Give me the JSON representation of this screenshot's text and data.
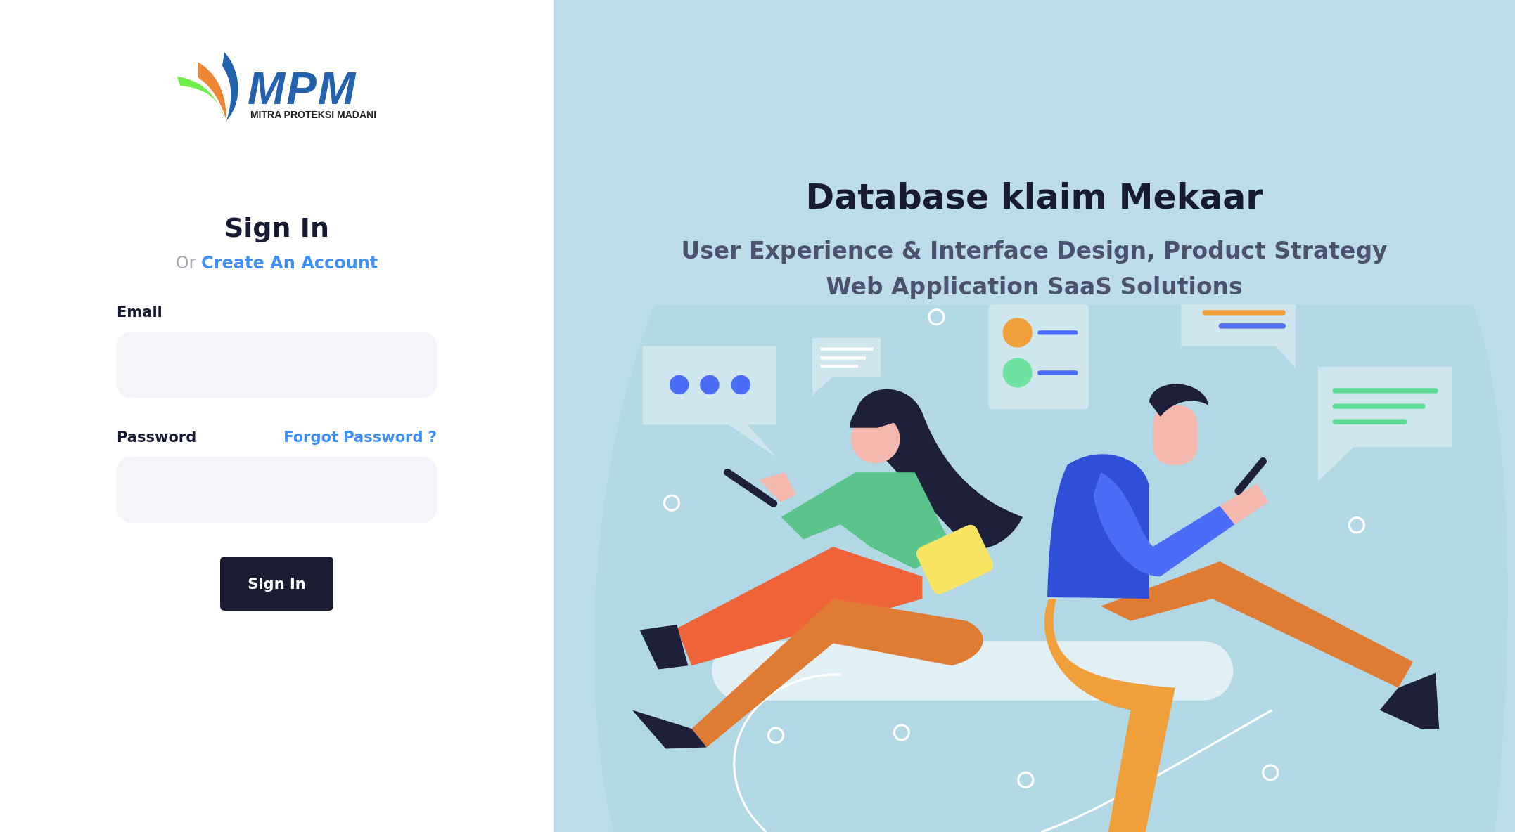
{
  "logo": {
    "wordmark": "MPM",
    "tagline": "MITRA PROTEKSI MADANI"
  },
  "sign_in": {
    "title": "Sign In",
    "alt_prefix": "Or",
    "create_account_link": "Create An Account",
    "fields": [
      {
        "label": "Email"
      },
      {
        "label": "Password",
        "link": "Forgot Password ?"
      }
    ],
    "button": "Sign In"
  },
  "hero": {
    "title": "Database klaim Mekaar",
    "subtitle_lines": [
      "User Experience & Interface Design, Product Strategy",
      "Web Application SaaS Solutions"
    ]
  }
}
